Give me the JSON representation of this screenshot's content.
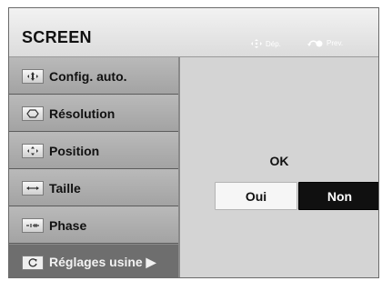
{
  "header": {
    "title": "SCREEN",
    "hints": [
      {
        "icon": "move-arrows-icon",
        "label": "Dép."
      },
      {
        "icon": "return-icon",
        "label": "Prev."
      }
    ]
  },
  "menu": {
    "items": [
      {
        "label": "Config. auto.",
        "icon": "auto-config-icon"
      },
      {
        "label": "Résolution",
        "icon": "resolution-icon"
      },
      {
        "label": "Position",
        "icon": "position-icon"
      },
      {
        "label": "Taille",
        "icon": "size-icon"
      },
      {
        "label": "Phase",
        "icon": "phase-icon"
      },
      {
        "label": "Réglages usine ▶",
        "icon": "reset-icon",
        "selected": true
      }
    ]
  },
  "dialog": {
    "prompt": "OK",
    "yes_label": "Oui",
    "no_label": "Non",
    "focused": "Non"
  }
}
